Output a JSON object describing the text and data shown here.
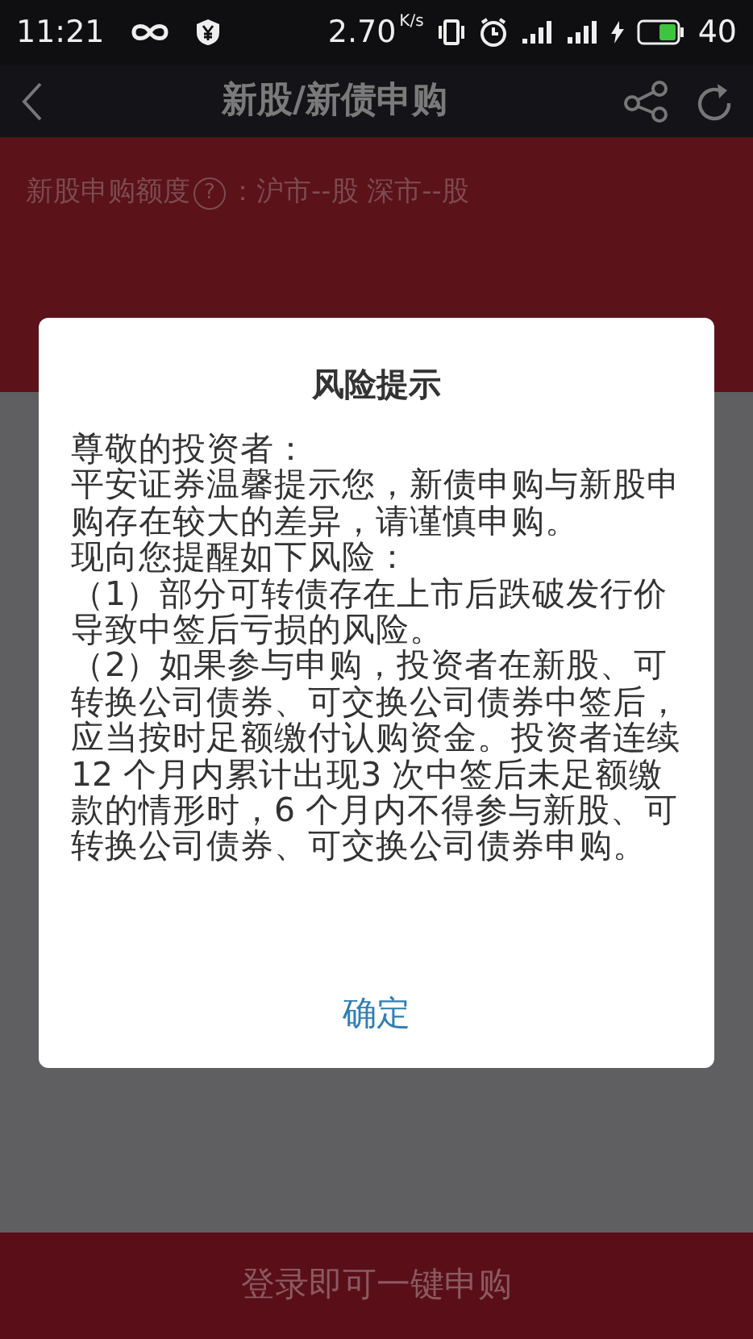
{
  "status_bar": {
    "time": "11:21",
    "speed": "2.70",
    "speed_unit": "K/s",
    "battery": "40"
  },
  "header": {
    "title": "新股/新债申购"
  },
  "quota": {
    "label": "新股申购额度",
    "help_icon": "?",
    "separator": "：",
    "value": "沪市--股 深市--股"
  },
  "dialog": {
    "title": "风险提示",
    "paragraphs": [
      "尊敬的投资者：",
      "平安证券温馨提示您，新债申购与新股申购存在较大的差异，请谨慎申购。",
      "现向您提醒如下风险：",
      "（1）部分可转债存在上市后跌破发行价导致中签后亏损的风险。",
      "（2）如果参与申购，投资者在新股、可转换公司债券、可交换公司债券中签后，应当按时足额缴付认购资金。投资者连续12 个月内累计出现3 次中签后未足额缴款的情形时，6 个月内不得参与新股、可转换公司债券、可交换公司债券申购。"
    ],
    "confirm": "确定"
  },
  "login_bar": {
    "text": "登录即可一键申购"
  }
}
